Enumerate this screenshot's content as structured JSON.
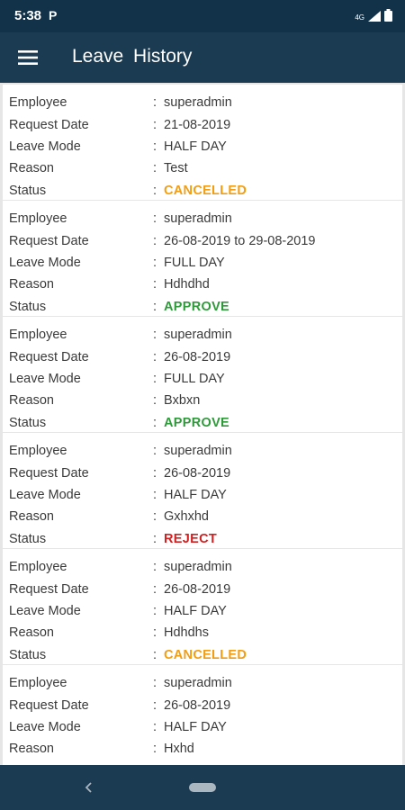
{
  "status_bar": {
    "time": "5:38",
    "app_indicator": "P",
    "network": "4G"
  },
  "app_bar": {
    "title": "Leave  History"
  },
  "colors": {
    "cancelled": "#f29d12",
    "approve": "#2e9a3a",
    "reject": "#d32020"
  },
  "labels": {
    "employee": "Employee",
    "request_date": "Request Date",
    "leave_mode": "Leave Mode",
    "reason": "Reason",
    "status": "Status"
  },
  "colon": ":",
  "records": [
    {
      "employee": "superadmin",
      "request_date": "21-08-2019",
      "leave_mode": "HALF DAY",
      "reason": "Test",
      "status": "CANCELLED",
      "status_color": "#f29d12"
    },
    {
      "employee": "superadmin",
      "request_date": "26-08-2019 to 29-08-2019",
      "leave_mode": "FULL DAY",
      "reason": "Hdhdhd",
      "status": "APPROVE",
      "status_color": "#2e9a3a"
    },
    {
      "employee": "superadmin",
      "request_date": "26-08-2019",
      "leave_mode": "FULL DAY",
      "reason": "Bxbxn",
      "status": "APPROVE",
      "status_color": "#2e9a3a"
    },
    {
      "employee": "superadmin",
      "request_date": "26-08-2019",
      "leave_mode": "HALF DAY",
      "reason": "Gxhxhd",
      "status": "REJECT",
      "status_color": "#d32020"
    },
    {
      "employee": "superadmin",
      "request_date": "26-08-2019",
      "leave_mode": "HALF DAY",
      "reason": "Hdhdhs",
      "status": "CANCELLED",
      "status_color": "#f29d12"
    },
    {
      "employee": "superadmin",
      "request_date": "26-08-2019",
      "leave_mode": "HALF DAY",
      "reason": "Hxhd",
      "status": "",
      "status_color": ""
    }
  ],
  "icons": {
    "menu": "hamburger-menu-icon",
    "back": "back-chevron-icon",
    "signal": "signal-icon",
    "battery": "battery-icon"
  }
}
